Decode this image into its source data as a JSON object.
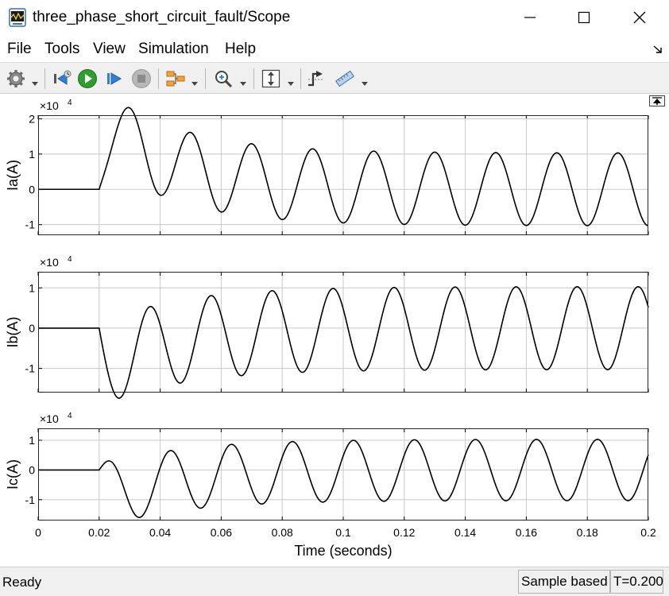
{
  "window": {
    "title": "three_phase_short_circuit_fault/Scope"
  },
  "menu": {
    "items": [
      {
        "id": "file",
        "label": "File"
      },
      {
        "id": "tools",
        "label": "Tools"
      },
      {
        "id": "view",
        "label": "View"
      },
      {
        "id": "simulation",
        "label": "Simulation"
      },
      {
        "id": "help",
        "label": "Help"
      }
    ]
  },
  "toolbar": {
    "icons": [
      "gear-icon",
      "step-back-icon",
      "run-icon",
      "step-forward-icon",
      "stop-icon",
      "signal-selector-icon",
      "zoom-icon",
      "fit-to-view-icon",
      "triggers-icon",
      "measurements-icon"
    ]
  },
  "colors": {
    "toolbar_bg": "#f0f0f0",
    "run_green": "#2e9e2e",
    "step_blue": "#2f7fd6",
    "trace": "#000000",
    "grid": "#c8c8c8"
  },
  "chart_data": [
    {
      "type": "line",
      "ylabel": "Ia(A)",
      "yscale_exponent": "4",
      "yticks": [
        "-1",
        "0",
        "1",
        "2"
      ],
      "ylim": [
        -1.3,
        2.1
      ],
      "xlim": [
        0,
        0.2
      ],
      "fault_time": 0.02,
      "amplitude": 1.03,
      "phase_deg": 0,
      "dc_offset": 0.9,
      "dc_tau": 0.025,
      "grid": true
    },
    {
      "type": "line",
      "ylabel": "Ib(A)",
      "yscale_exponent": "4",
      "yticks": [
        "-1",
        "0",
        "1"
      ],
      "ylim": [
        -1.6,
        1.4
      ],
      "xlim": [
        0,
        0.2
      ],
      "fault_time": 0.02,
      "amplitude": 1.03,
      "phase_deg": -120,
      "dc_offset": -0.45,
      "dc_tau": 0.025,
      "grid": true
    },
    {
      "type": "line",
      "ylabel": "Ic(A)",
      "yscale_exponent": "4",
      "yticks": [
        "-1",
        "0",
        "1"
      ],
      "ylim": [
        -1.7,
        1.4
      ],
      "xlim": [
        0,
        0.2
      ],
      "fault_time": 0.02,
      "amplitude": 1.03,
      "phase_deg": 120,
      "dc_offset": -0.45,
      "dc_tau": 0.025,
      "grid": true
    }
  ],
  "xaxis": {
    "label": "Time (seconds)",
    "ticks": [
      "0",
      "0.02",
      "0.04",
      "0.06",
      "0.08",
      "0.1",
      "0.12",
      "0.14",
      "0.16",
      "0.18",
      "0.2"
    ]
  },
  "status": {
    "ready": "Ready",
    "mode": "Sample based",
    "time": "T=0.200"
  }
}
